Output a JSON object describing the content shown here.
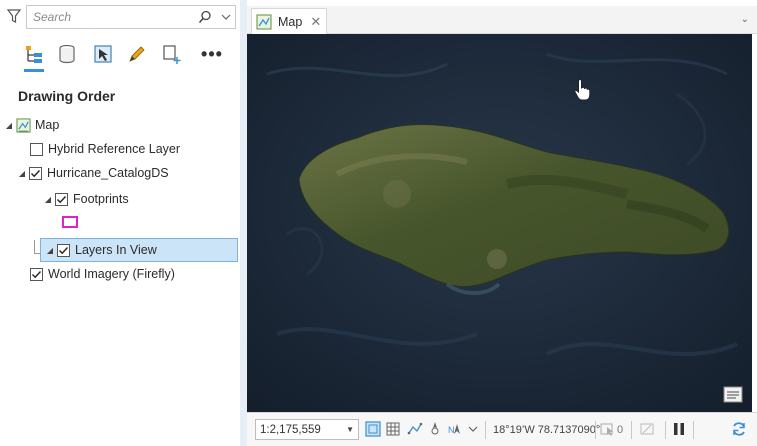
{
  "contents_pane": {
    "search": {
      "placeholder": "Search"
    },
    "toolbar": {
      "buttons": [
        {
          "name": "list-by-drawing-order",
          "icon": "drawing-order-icon"
        },
        {
          "name": "list-by-data-source",
          "icon": "database-icon"
        },
        {
          "name": "list-by-selection",
          "icon": "selection-icon"
        },
        {
          "name": "list-by-editing",
          "icon": "pencil-icon"
        },
        {
          "name": "list-by-snapping",
          "icon": "snapping-icon"
        }
      ],
      "more_label": "•••"
    },
    "heading": "Drawing Order",
    "tree": {
      "map": "Map",
      "hybrid_reference": "Hybrid Reference Layer",
      "catalog": "Hurricane_CatalogDS",
      "footprints": "Footprints",
      "layers_in_view": "Layers In View",
      "world_imagery": "World Imagery (Firefly)"
    }
  },
  "map_view": {
    "tab_title": "Map",
    "tab_close": "✕",
    "tabbar_chevron": "⌄"
  },
  "status_bar": {
    "scale": "1:2,175,559",
    "coordinates": "18°19’W 78.7137090°",
    "selected_count": "0"
  },
  "colors": {
    "accent": "#3a8fd6",
    "selection_bg": "#cce4f7",
    "footprint_outline": "#e020c8",
    "ocean": "#1b2838",
    "land": "#4a5a32"
  }
}
